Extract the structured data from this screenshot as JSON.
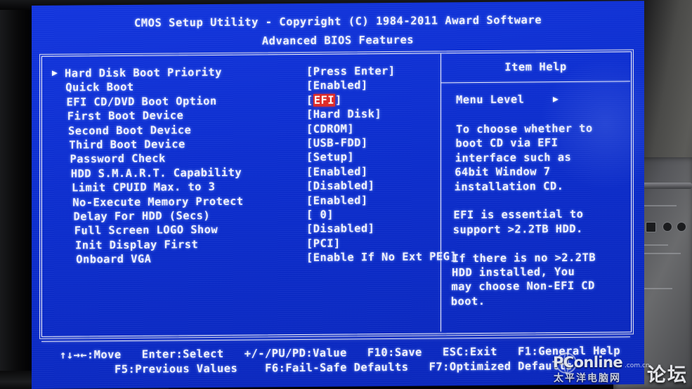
{
  "header": {
    "title": "CMOS Setup Utility - Copyright (C) 1984-2011 Award Software",
    "subtitle": "Advanced BIOS Features"
  },
  "settings": [
    {
      "label": "Hard Disk Boot Priority",
      "value": "[Press Enter]",
      "caret": "▶",
      "selected": false,
      "submenu": true
    },
    {
      "label": "Quick Boot",
      "value": "[Enabled]",
      "caret": "",
      "selected": false,
      "submenu": false
    },
    {
      "label": "EFI CD/DVD Boot Option",
      "value": "[EFI]",
      "caret": "",
      "selected": true,
      "submenu": false,
      "highlight_text": "EFI"
    },
    {
      "label": "First Boot Device",
      "value": "[Hard Disk]",
      "caret": "",
      "selected": false,
      "submenu": false
    },
    {
      "label": "Second Boot Device",
      "value": "[CDROM]",
      "caret": "",
      "selected": false,
      "submenu": false
    },
    {
      "label": "Third Boot Device",
      "value": "[USB-FDD]",
      "caret": "",
      "selected": false,
      "submenu": false
    },
    {
      "label": "Password Check",
      "value": "[Setup]",
      "caret": "",
      "selected": false,
      "submenu": false
    },
    {
      "label": "HDD S.M.A.R.T. Capability",
      "value": "[Enabled]",
      "caret": "",
      "selected": false,
      "submenu": false
    },
    {
      "label": "Limit CPUID Max. to 3",
      "value": "[Disabled]",
      "caret": "",
      "selected": false,
      "submenu": false
    },
    {
      "label": "No-Execute Memory Protect",
      "value": "[Enabled]",
      "caret": "",
      "selected": false,
      "submenu": false
    },
    {
      "label": "Delay For HDD (Secs)",
      "value": "[ 0]",
      "caret": "",
      "selected": false,
      "submenu": false
    },
    {
      "label": "Full Screen LOGO Show",
      "value": "[Disabled]",
      "caret": "",
      "selected": false,
      "submenu": false
    },
    {
      "label": "Init Display First",
      "value": "[PCI]",
      "caret": "",
      "selected": false,
      "submenu": false
    },
    {
      "label": "Onboard VGA",
      "value": "[Enable If No Ext PEG]",
      "caret": "",
      "selected": false,
      "submenu": false
    }
  ],
  "item_help": {
    "title": "Item Help",
    "menu_level_label": "Menu Level",
    "menu_level_arrow": "▶",
    "body_lines": [
      "To choose whether to",
      "boot CD via EFI",
      "interface such as",
      "64bit Window 7",
      "installation CD.",
      "",
      "EFI is essential to",
      "support >2.2TB HDD.",
      "",
      "If there is no >2.2TB",
      "HDD installed, You",
      "may choose Non-EFI CD",
      "boot."
    ]
  },
  "footer": {
    "line1": "↑↓→←:Move   Enter:Select   +/-/PU/PD:Value   F10:Save   ESC:Exit   F1:General Help",
    "line2": "F5:Previous Values    F6:Fail-Safe Defaults   F7:Optimized Defaults"
  },
  "watermark": {
    "main": "PConline",
    "suffix": ".com.cn",
    "chinese": "太平洋电脑网",
    "forum": "论坛",
    "dots": "···"
  },
  "colors": {
    "screen_blue": "#0d2fd4",
    "text_white": "#f2f4ff",
    "highlight_red": "#e22a27",
    "frame_white": "#f0f0fa"
  }
}
